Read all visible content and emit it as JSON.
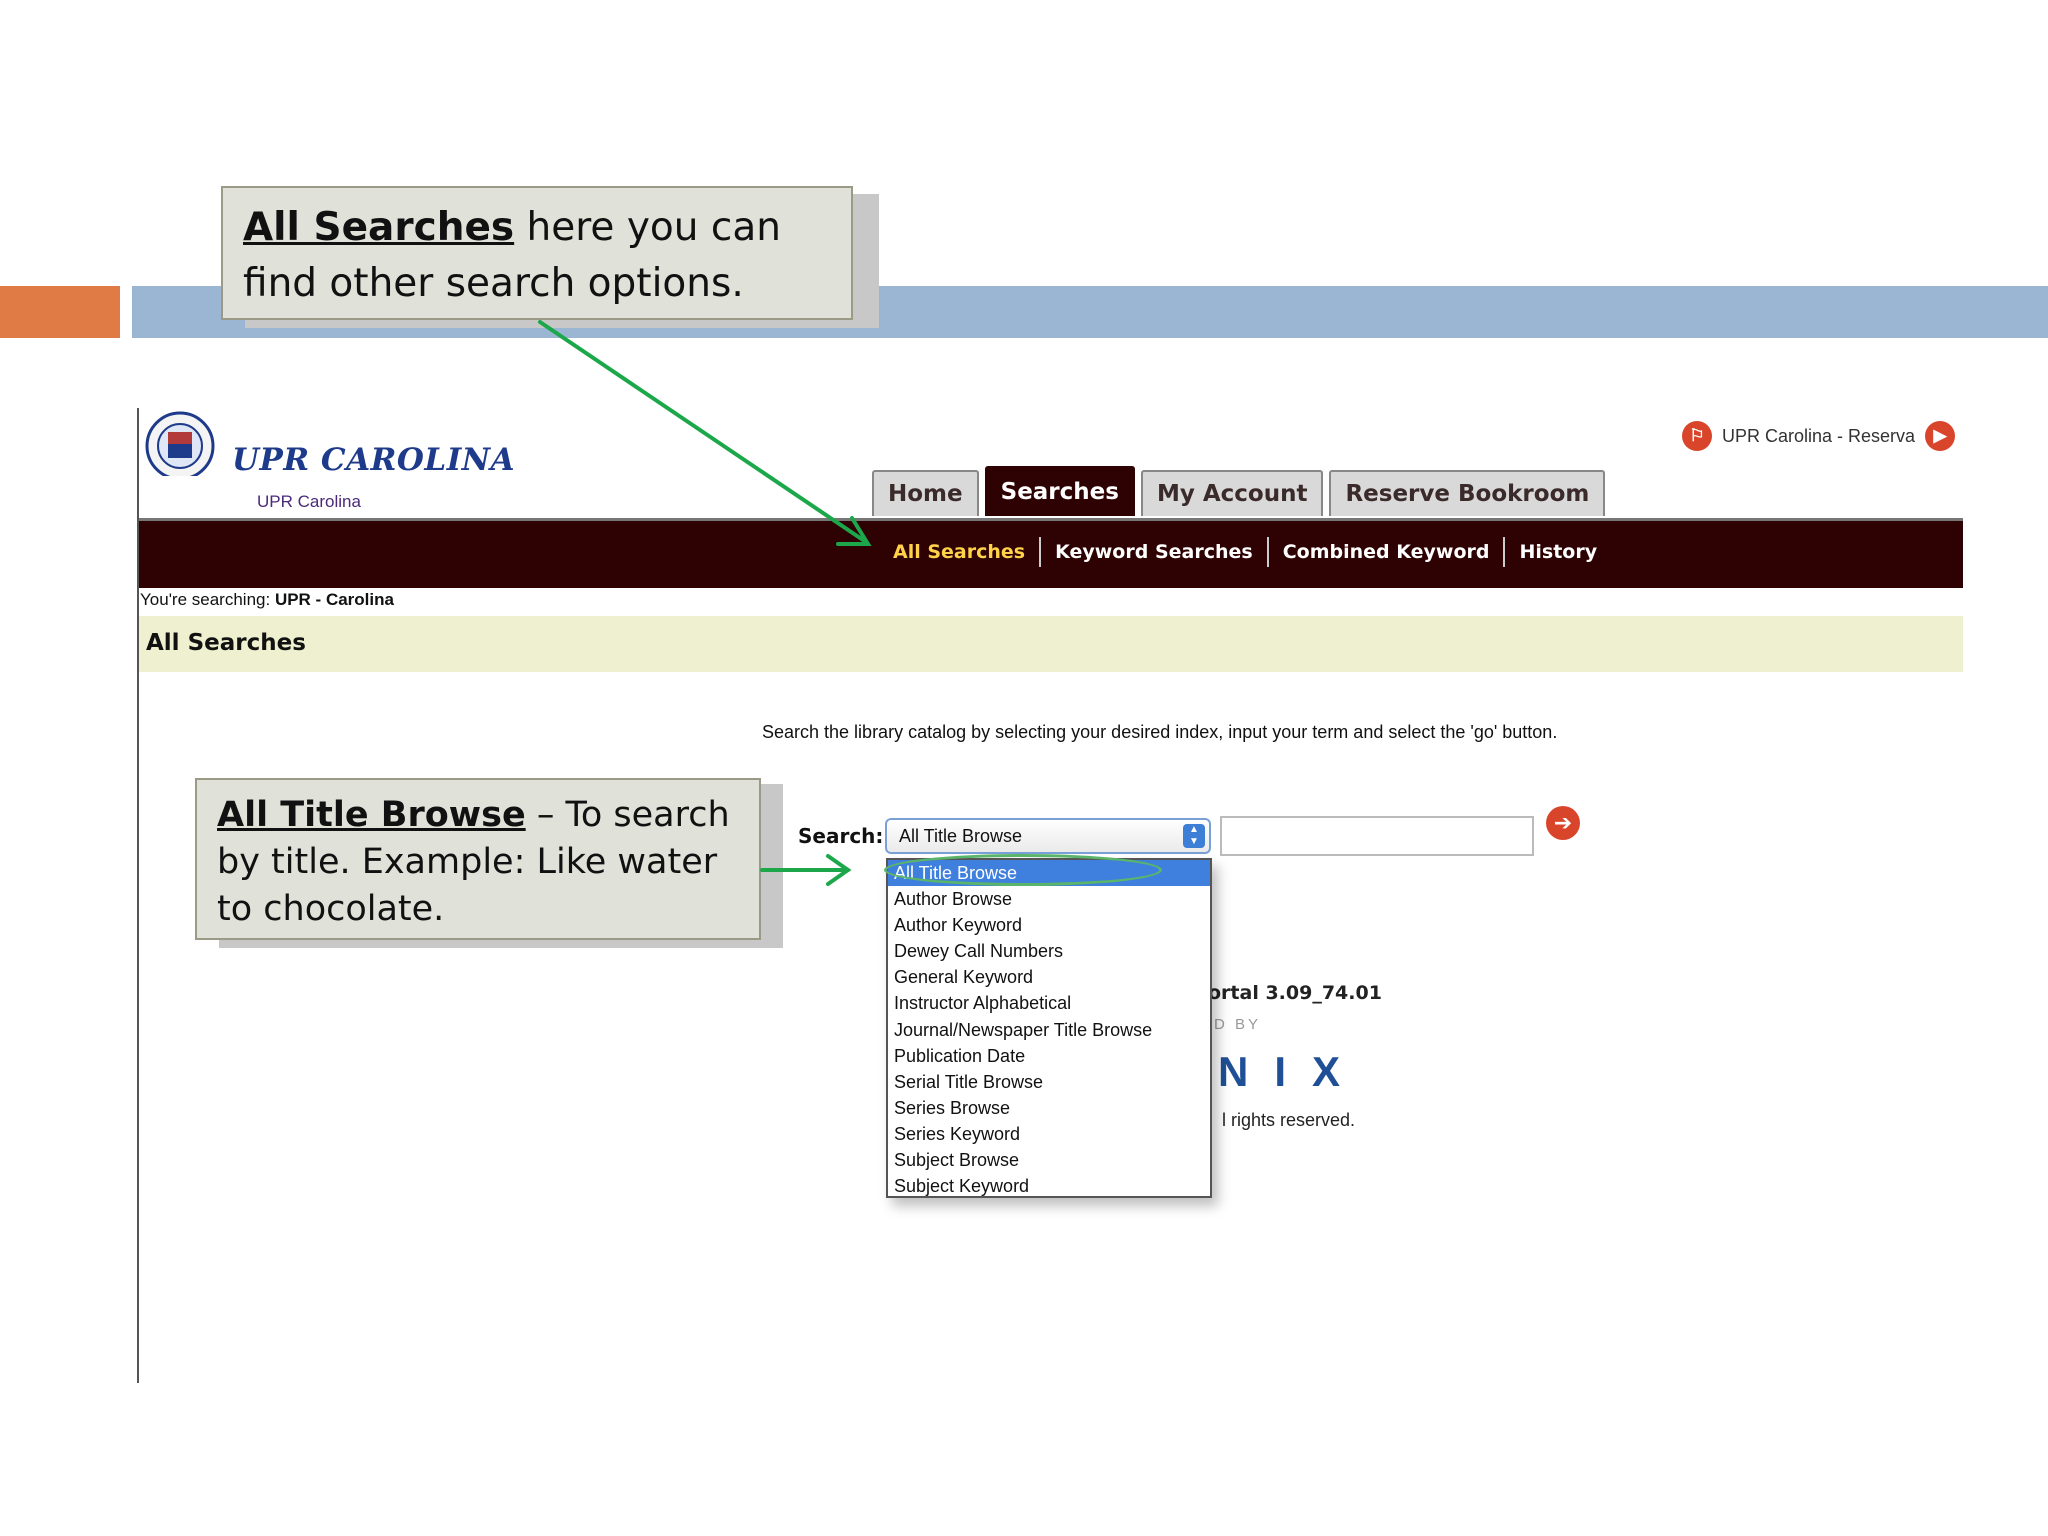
{
  "slide": {
    "colors": {
      "orange_bar": "#e07b45",
      "blue_bar": "#9bb6d3",
      "arrow": "#1ca84a"
    }
  },
  "callouts": {
    "all_searches": {
      "highlight": "All Searches",
      "text": " here you can find other search options."
    },
    "all_title_browse": {
      "highlight": "All Title Browse",
      "text": " – To search by title. Example: Like water to chocolate."
    }
  },
  "site": {
    "logo_text": "UPR CAROLINA",
    "logo_sub": "UPR Carolina",
    "top_right_link": "UPR Carolina - Reserva",
    "tabs": [
      {
        "label": "Home",
        "active": false
      },
      {
        "label": "Searches",
        "active": true
      },
      {
        "label": "My Account",
        "active": false
      },
      {
        "label": "Reserve Bookroom",
        "active": false
      }
    ],
    "subnav": [
      {
        "label": "All Searches",
        "current": true
      },
      {
        "label": "Keyword Searches",
        "current": false
      },
      {
        "label": "Combined Keyword",
        "current": false
      },
      {
        "label": "History",
        "current": false
      }
    ],
    "searching_prefix": "You're searching: ",
    "searching_target": "UPR - Carolina",
    "page_title": "All Searches",
    "instructions": "Search the library catalog by selecting your desired index, input your term and select the 'go' button.",
    "search_label": "Search:",
    "select_value": "All Title Browse",
    "search_input_value": "",
    "dropdown_options": [
      "All Title Browse",
      "Author Browse",
      "Author Keyword",
      "Dewey Call Numbers",
      "General Keyword",
      "Instructor Alphabetical",
      "Journal/Newspaper Title Browse",
      "Publication Date",
      "Serial Title Browse",
      "Series Browse",
      "Series Keyword",
      "Subject Browse",
      "Subject Keyword"
    ],
    "portal_version": "ortal 3.09_74.01",
    "powered_by": "D BY",
    "dynix": "NIX",
    "rights": "l rights reserved."
  }
}
